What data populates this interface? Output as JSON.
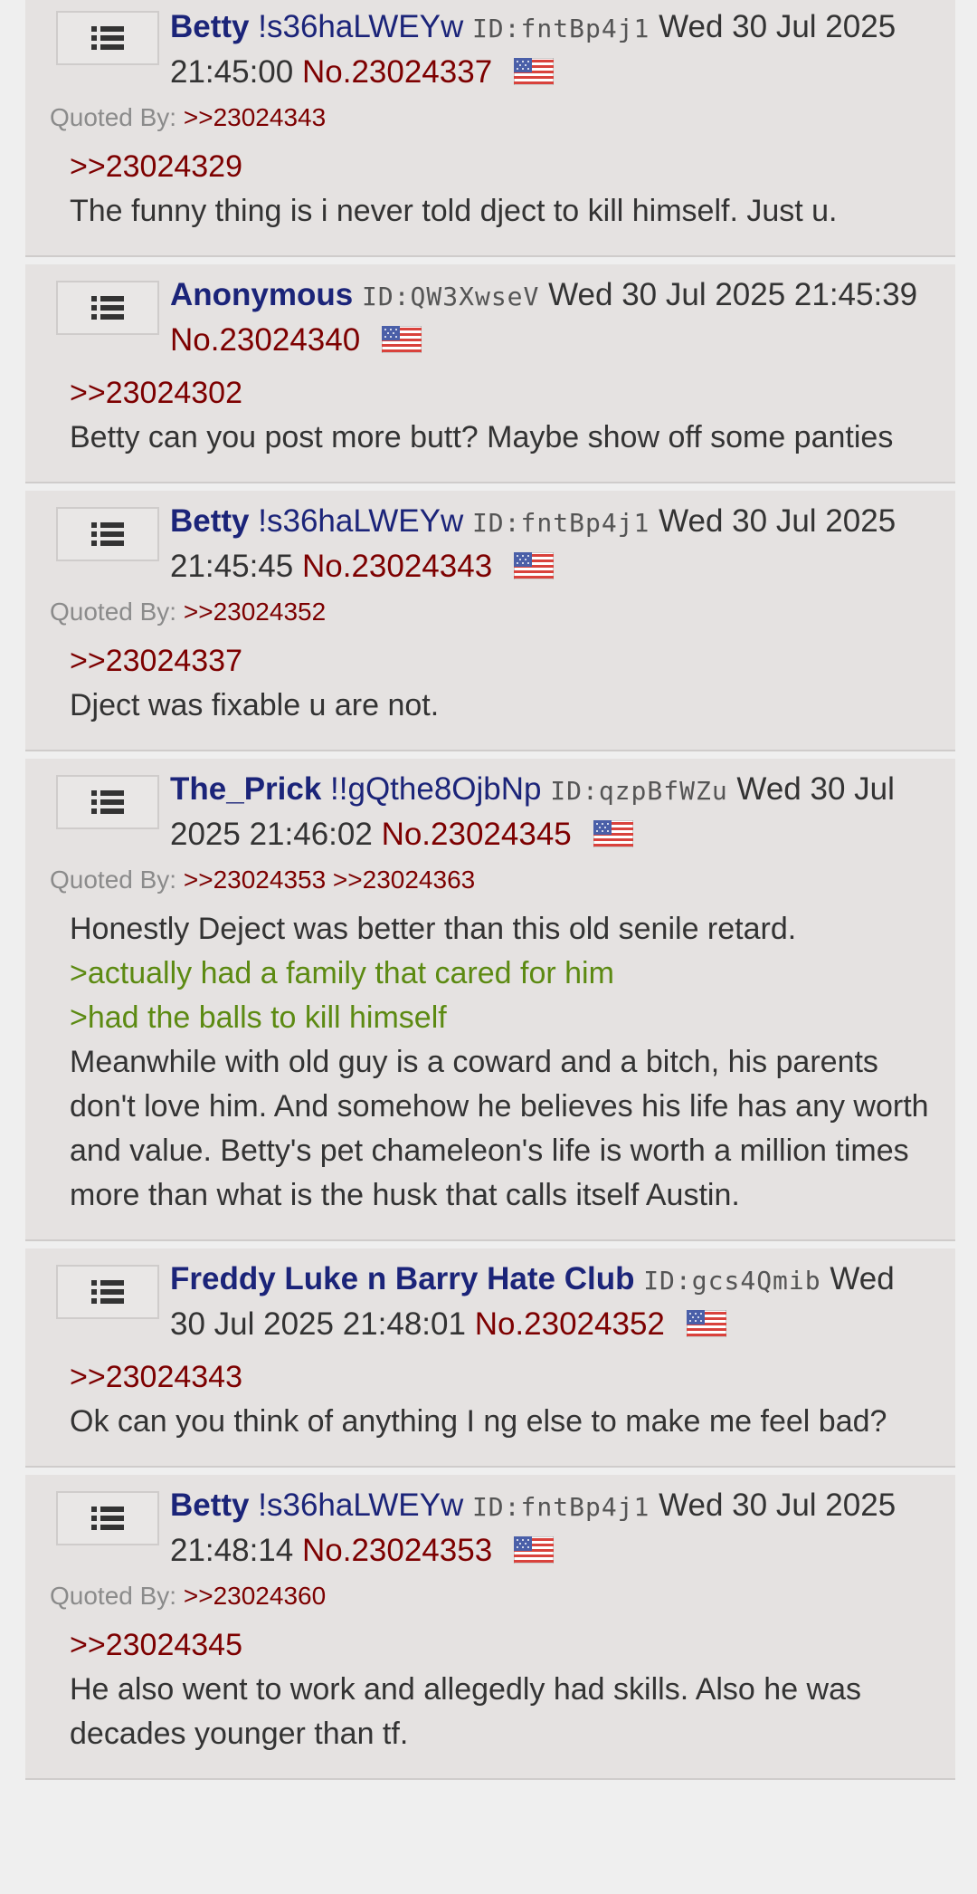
{
  "colors": {
    "name": "#1b2479",
    "post_number": "#7d0000",
    "greentext": "#5c8a12",
    "post_bg": "#e5e2e1"
  },
  "icons": {
    "menu": "menu-list-icon",
    "flag": "us-flag-icon"
  },
  "posts": [
    {
      "name": "Betty",
      "trip": "!s36haLWEYw",
      "id": "ID:fntBp4j1",
      "datetime": "Wed 30 Jul 2025 21:45:00",
      "no": "No.23024337",
      "quoted_label": "Quoted By:",
      "quoted_by": ">>23024343",
      "reply_to": ">>23024329",
      "text": "The funny thing is i never told dject to kill himself. Just u."
    },
    {
      "name": "Anonymous",
      "trip": "",
      "id": "ID:QW3XwseV",
      "datetime": "Wed 30 Jul 2025 21:45:39",
      "no": "No.23024340",
      "reply_to": ">>23024302",
      "text": "Betty can you post more butt? Maybe show off some panties"
    },
    {
      "name": "Betty",
      "trip": "!s36haLWEYw",
      "id": "ID:fntBp4j1",
      "datetime": "Wed 30 Jul 2025 21:45:45",
      "no": "No.23024343",
      "quoted_label": "Quoted By:",
      "quoted_by": ">>23024352",
      "reply_to": ">>23024337",
      "text": "Dject was fixable u are not."
    },
    {
      "name": "The_Prick",
      "trip": "!!gQthe8OjbNp",
      "id": "ID:qzpBfWZu",
      "datetime": "Wed 30 Jul 2025 21:46:02",
      "no": "No.23024345",
      "quoted_label": "Quoted By:",
      "quoted_by": ">>23024353 >>23024363",
      "line1": "Honestly Deject was better than this old senile retard.",
      "green1": ">actually had a family that cared for him",
      "green2": ">had the balls to kill himself",
      "text": "Meanwhile with old guy is a coward and a bitch, his parents don't love him. And somehow he believes his life has any worth and value. Betty's pet chameleon's life is worth a million times more than what is the husk that calls itself Austin."
    },
    {
      "name": "Freddy Luke n Barry Hate Club",
      "trip": "",
      "id": "ID:gcs4Qmib",
      "datetime": "Wed 30 Jul 2025 21:48:01",
      "no": "No.23024352",
      "reply_to": ">>23024343",
      "text": "Ok can you think of anything I ng else to make me feel bad?"
    },
    {
      "name": "Betty",
      "trip": "!s36haLWEYw",
      "id": "ID:fntBp4j1",
      "datetime": "Wed 30 Jul 2025 21:48:14",
      "no": "No.23024353",
      "quoted_label": "Quoted By:",
      "quoted_by": ">>23024360",
      "reply_to": ">>23024345",
      "text": "He also went to work and allegedly had skills. Also he was decades younger than tf."
    }
  ]
}
